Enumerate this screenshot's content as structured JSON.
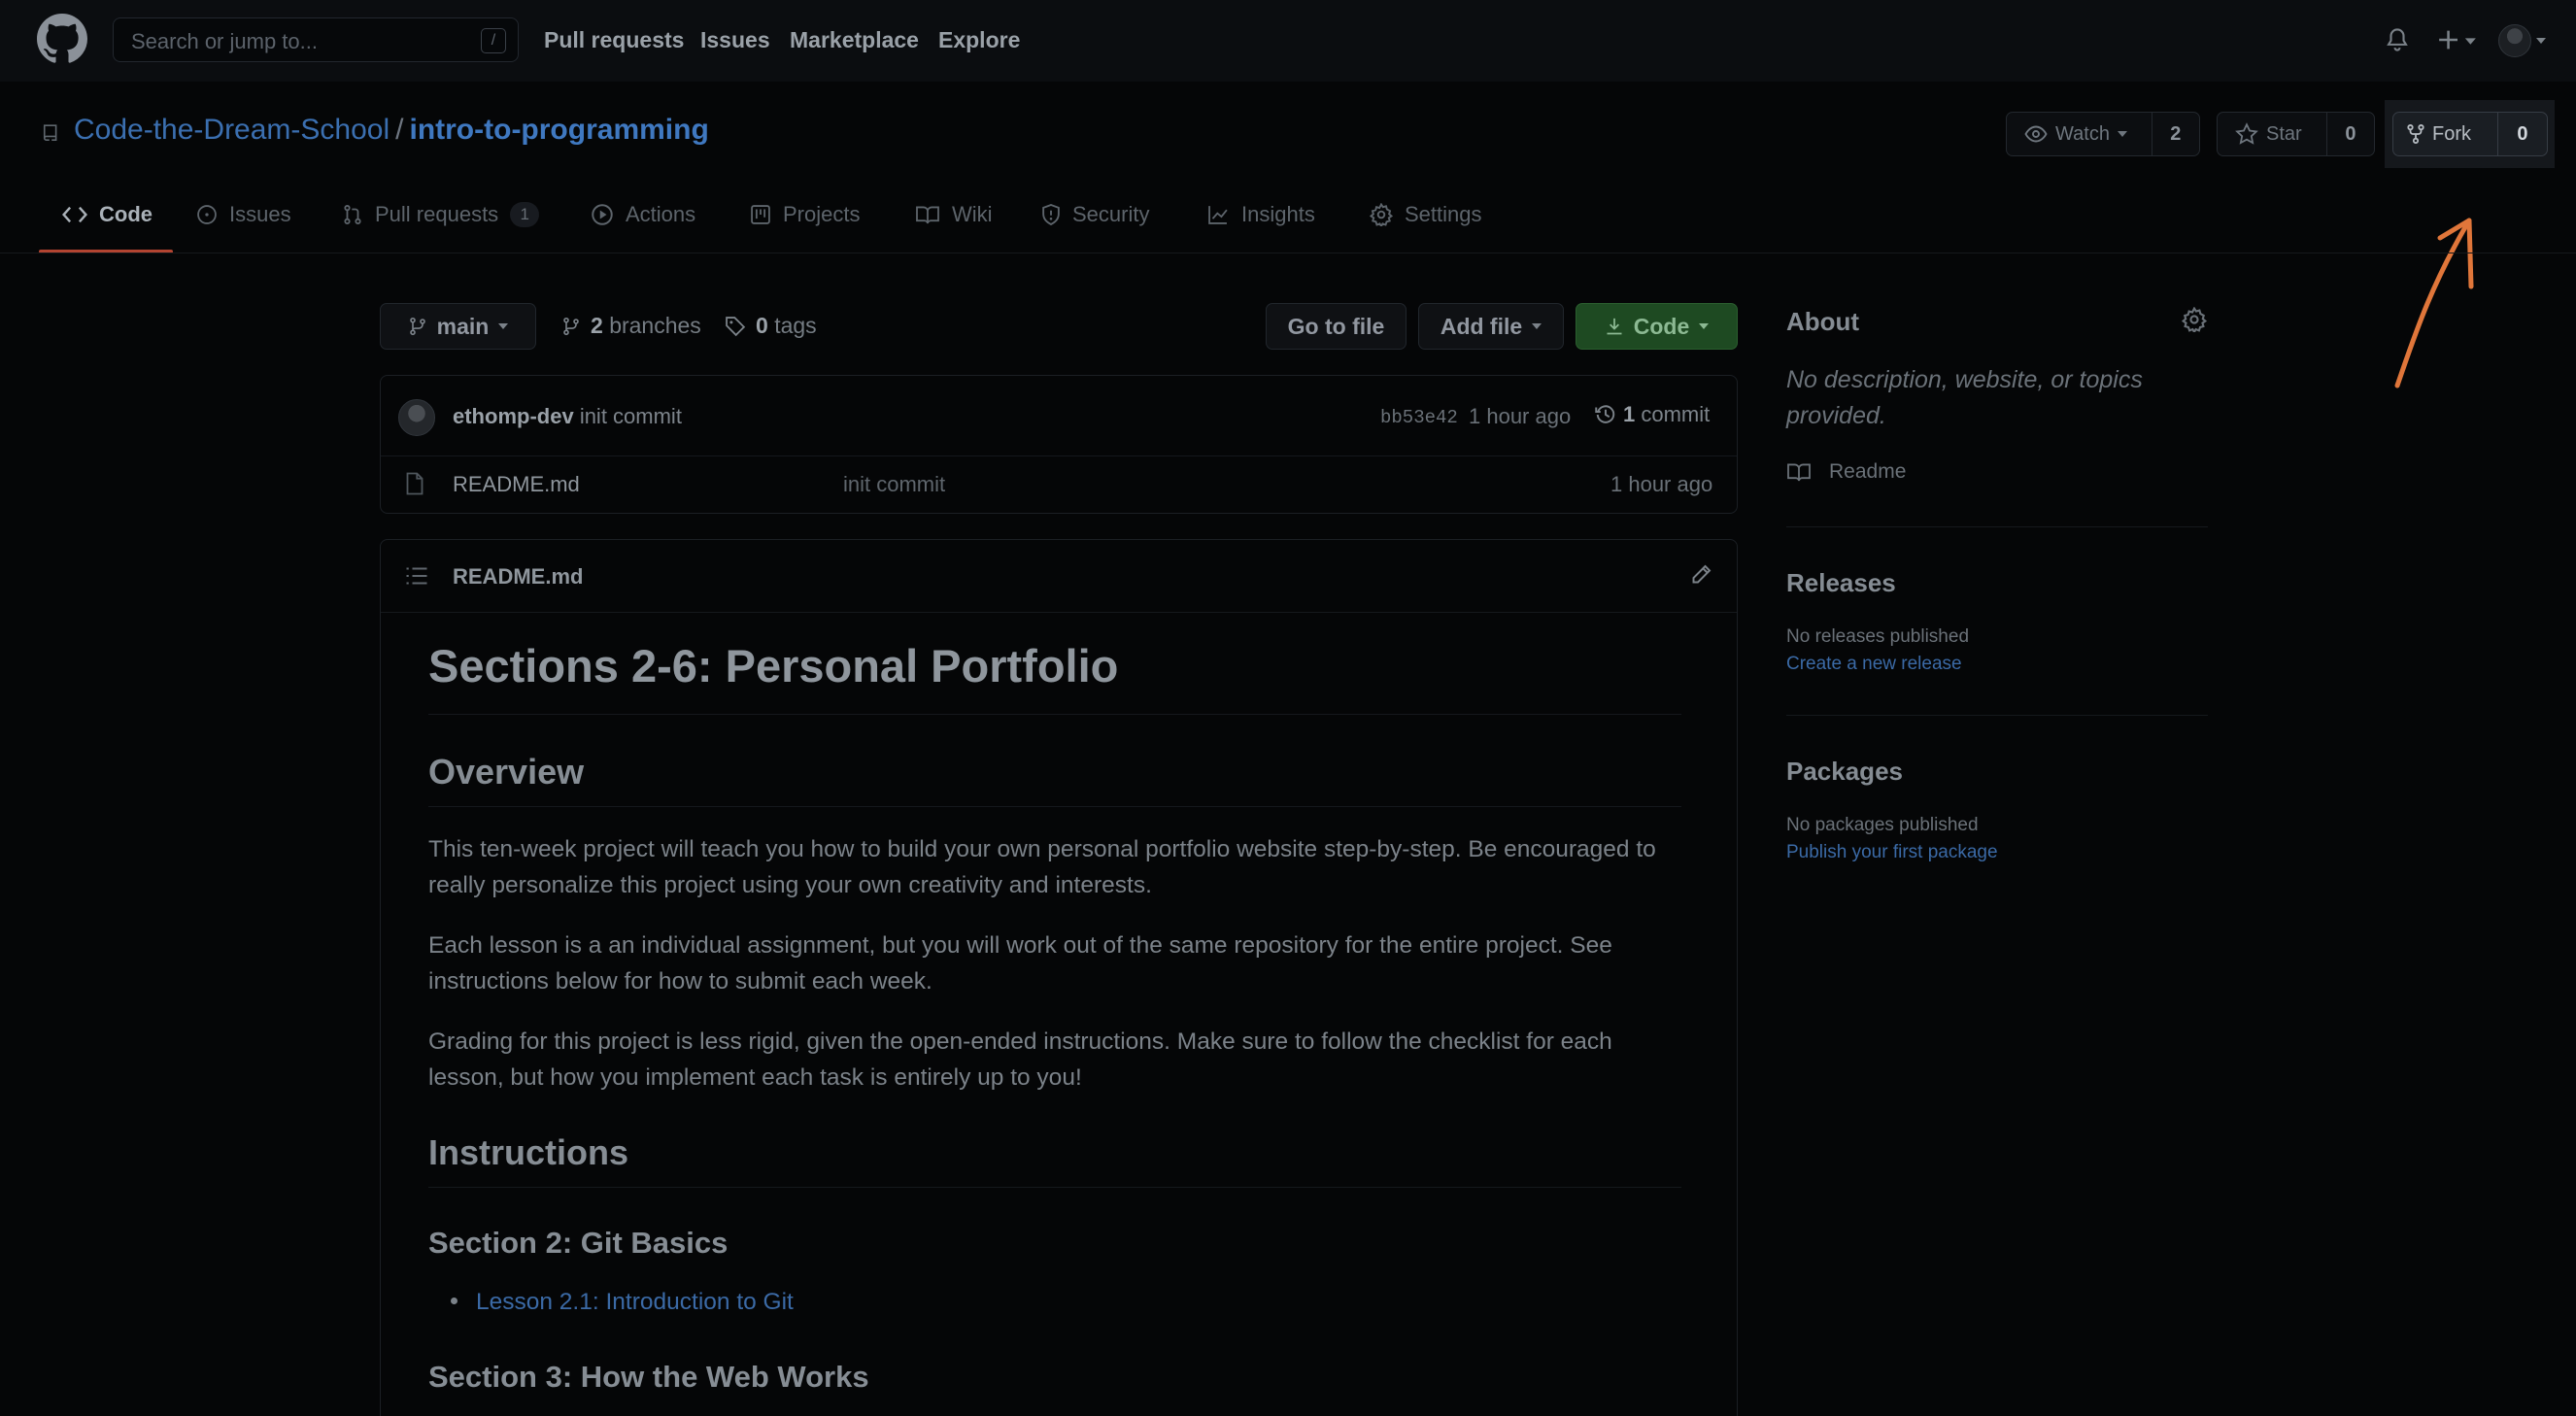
{
  "header": {
    "search_placeholder": "Search or jump to...",
    "search_shortcut": "/",
    "nav": [
      "Pull requests",
      "Issues",
      "Marketplace",
      "Explore"
    ]
  },
  "repo": {
    "owner": "Code-the-Dream-School",
    "separator": "/",
    "name": "intro-to-programming",
    "watch_label": "Watch",
    "watch_count": "2",
    "star_label": "Star",
    "star_count": "0",
    "fork_label": "Fork",
    "fork_count": "0"
  },
  "tabs": [
    {
      "label": "Code",
      "icon": "code-icon",
      "active": true
    },
    {
      "label": "Issues",
      "icon": "issue-icon"
    },
    {
      "label": "Pull requests",
      "icon": "pull-request-icon",
      "badge": "1"
    },
    {
      "label": "Actions",
      "icon": "play-icon"
    },
    {
      "label": "Projects",
      "icon": "project-icon"
    },
    {
      "label": "Wiki",
      "icon": "book-icon"
    },
    {
      "label": "Security",
      "icon": "shield-icon"
    },
    {
      "label": "Insights",
      "icon": "graph-icon"
    },
    {
      "label": "Settings",
      "icon": "gear-icon"
    }
  ],
  "branch_bar": {
    "branch": "main",
    "branches_count": "2",
    "branches_label": "branches",
    "tags_count": "0",
    "tags_label": "tags",
    "go_to_file": "Go to file",
    "add_file": "Add file",
    "code": "Code"
  },
  "latest_commit": {
    "author": "ethomp-dev",
    "message": "init commit",
    "sha": "bb53e42",
    "time": "1 hour ago",
    "commits_count": "1",
    "commits_label": "commit"
  },
  "files": [
    {
      "name": "README.md",
      "message": "init commit",
      "time": "1 hour ago"
    }
  ],
  "readme": {
    "filename": "README.md",
    "h1": "Sections 2-6: Personal Portfolio",
    "overview_heading": "Overview",
    "p1": "This ten-week project will teach you how to build your own personal portfolio website step-by-step. Be encouraged to really personalize this project using your own creativity and interests.",
    "p2": "Each lesson is a an individual assignment, but you will work out of the same repository for the entire project. See instructions below for how to submit each week.",
    "p3": "Grading for this project is less rigid, given the open-ended instructions. Make sure to follow the checklist for each lesson, but how you implement each task is entirely up to you!",
    "instructions_heading": "Instructions",
    "section2_heading": "Section 2: Git Basics",
    "lesson_link": "Lesson 2.1: Introduction to Git",
    "section3_heading": "Section 3: How the Web Works"
  },
  "sidebar": {
    "about_heading": "About",
    "about_text": "No description, website, or topics provided.",
    "readme_link": "Readme",
    "releases_heading": "Releases",
    "releases_text": "No releases published",
    "releases_link": "Create a new release",
    "packages_heading": "Packages",
    "packages_text": "No packages published",
    "packages_link": "Publish your first package"
  },
  "colors": {
    "annotation_arrow": "#e0763a",
    "active_tab_underline": "#b34431",
    "link": "#3b6fb0"
  }
}
